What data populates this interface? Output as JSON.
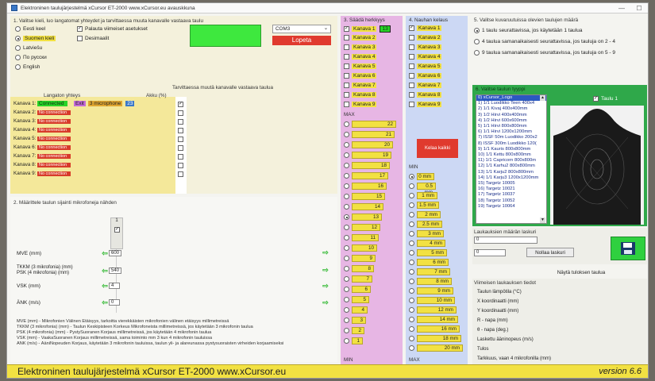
{
  "window": {
    "title": "Elektroninen taulujärjestelmä  xCursor ET-2000 www.xCursor.eu avauskkuna",
    "min_label": "—",
    "max_label": "☐"
  },
  "section1": {
    "header": "1. Valitse kieli, luo langatomat yhteydet ja tarvittaessa muuta kanavalle vastaava taulu",
    "languages": [
      "Eesti keel",
      "Suomen kieli",
      "Latviešu",
      "По русски",
      "English"
    ],
    "selected_language": "Suomen kieli",
    "restore_label": "Palauta viimeiset asetukset",
    "decimal_label": "Desimaalit",
    "com_port": "COM3",
    "stop_label": "Lopeta",
    "wireless_header": "Langaton yhteys",
    "battery_header": "Akku (%)",
    "change_table_header": "Tarvittaessa muutä kanavalle vastaava taulua",
    "channels": [
      {
        "name": "Kanava 1:",
        "status": "Connected",
        "extra1": "Exit",
        "extra2": "3 microphone",
        "battery": "23"
      },
      {
        "name": "Kanava 2:",
        "status": "No connection"
      },
      {
        "name": "Kanava 3:",
        "status": "No connection"
      },
      {
        "name": "Kanava 4:",
        "status": "No connection"
      },
      {
        "name": "Kanava 5:",
        "status": "No connection"
      },
      {
        "name": "Kanava 6:",
        "status": "No connection"
      },
      {
        "name": "Kanava 7:",
        "status": "No connection"
      },
      {
        "name": "Kanava 8:",
        "status": "No connection"
      },
      {
        "name": "Kanava 9:",
        "status": "No connection"
      }
    ]
  },
  "section2": {
    "header": "2. Määrittele taulun sijainti mikrofoneja nähden",
    "top_value": "1",
    "fields": [
      {
        "label": "MVE (mm)",
        "value": "600"
      },
      {
        "label": "TKKM (3 mikrofonia) (mm)\nPSK (4 mikrofonia) (mm)",
        "value": "540"
      },
      {
        "label": "VSK (mm)",
        "value": "4"
      },
      {
        "label": "ÄNK (m/s)",
        "value": "0"
      }
    ],
    "notes": [
      "MVE (mm) - Mikrofonien Välinen Etäisyys, tarkoitta vierekkäisten mikrofonien välinen etäisyys millimetreissä",
      "TKKM (3 mikrofonia) (mm) - Taulun Keskipisteen Korkeus Mikrofoneista millimetreissä, jos käytetään 3 mikrofonin taulua",
      "PSK (4 mikrofonia) (mm) - PystySuoranen Korjaus millimetreissä, jos käytetään 4 mikrofonin taulua",
      "VSK (mm) - VaakaSuoranen Korjaus millimetreissä, sama toiminto mm 3 kun 4 mikrofonin tauluissa",
      "ÄNK (m/s) - ÄäniNopeuden Korjaus, käytetään 3 mikrofonin tauluissa, taulun yli- ja alareunassa pystysuoraisten virheiden korjaamiseksi"
    ]
  },
  "section3": {
    "header": "3. Säädä herkkyys",
    "channels": [
      "Kanava 1",
      "Kanava 2",
      "Kanava 3",
      "Kanava 4",
      "Kanava 5",
      "Kanava 6",
      "Kanava 7",
      "Kanava 8",
      "Kanava 9"
    ],
    "ch1_value": "13",
    "max_label": "MAX",
    "min_label": "MIN",
    "levels": [
      "22",
      "21",
      "20",
      "19",
      "18",
      "17",
      "16",
      "15",
      "14",
      "13",
      "12",
      "11",
      "10",
      "9",
      "8",
      "7",
      "6",
      "5",
      "4",
      "3",
      "2",
      "1"
    ],
    "selected_level": "13"
  },
  "section4": {
    "header": "4. Nauhan kelaus",
    "channels": [
      "Kanava 1",
      "Kanava 2",
      "Kanava 3",
      "Kanava 4",
      "Kanava 5",
      "Kanava 6",
      "Kanava 7",
      "Kanava 8",
      "Kanava 9"
    ],
    "button_label": "Kelaa kaikki",
    "min_label": "MIN",
    "max_label": "MAX",
    "levels": [
      "0 mm",
      "0.5 mm",
      "1 mm",
      "1.5 mm",
      "2 mm",
      "2.5 mm",
      "3 mm",
      "4 mm",
      "5 mm",
      "6 mm",
      "7 mm",
      "8 mm",
      "9 mm",
      "10 mm",
      "12 mm",
      "14 mm",
      "16 mm",
      "18 mm",
      "20 mm"
    ],
    "selected_level": "0 mm"
  },
  "section5": {
    "header": "5. Valitse kuvaruutuissa olevien taulujen määrä",
    "options": [
      "1 taulu seurattavissa, jos käytetään 1 taulua",
      "4 taulua samanaikaisesti seurattavissa, jos tauluja on 2 - 4",
      "9 taulua samanaikaisesti seurattavissa, jos tauluja on 5 - 9"
    ],
    "selected_option": 0,
    "sub_header": "6. Valitse taulun tyyppi",
    "table_label": "Taulu 1",
    "list": [
      "0) xCursor_Logo",
      "1) 1/1 Luodikko Teen 400x4",
      "2) 1/1 Kivaj 400x400mm",
      "3) 1/2 Hirvi 400x400mm",
      "4) 1/2 Hirvi 600x600mm",
      "5) 1/1 Hirvi 800x800mm",
      "6) 1/1 Hirvi 1200x1200mm",
      "7) ISSF 50m Luodikko 200x2",
      "8) ISSF 300m Luodikko 120(",
      "9) 1/1 Kauris 800x800mm",
      "10) 1/1 Kettu 800x800mm",
      "11) 1/1 Capricorn 800x800m",
      "12) 1/1 Karhu2 800x800mm",
      "13) 1/1 Karju2 800x800mm",
      "14) 1/1 Karju3 1200x1200mm",
      "15) Targetz 10005",
      "16) Targetz 10021",
      "17) Targetz 10037",
      "18) Targetz 10052",
      "19) Targetz 10064"
    ],
    "selected_index": 0
  },
  "counter": {
    "header": "Laukauksien määrän laskuri",
    "value1": "0",
    "value2": "0",
    "reset_label": "Nollaa laskuri"
  },
  "results": {
    "show_button": "Näytä tuloksen taulua",
    "header": "Viimeisen laukauksen tiedot",
    "rows": [
      "Taulun lämpötila (°C)",
      "X koordinaatti (mm)",
      "Y koordinaatti (mm)",
      "R - napa (mm)",
      "θ - napa (deg.)",
      "Laskettu ääninopeus (m/s)",
      "Tulos",
      "Tarkkuus, vaan 4 mikrofonilla (mm)"
    ]
  },
  "footer": {
    "title": "Elektroninen taulujärjestelmä xCursor  ET-2000   www.xCursor.eu",
    "version": "version 6.6"
  },
  "colors": {
    "accent_yellow": "#f2e142",
    "connected_green": "#28d428",
    "error_red": "#d83b2a",
    "sensitivity_pink": "#e7b6e4",
    "reel_blue": "#ccd8f4"
  }
}
